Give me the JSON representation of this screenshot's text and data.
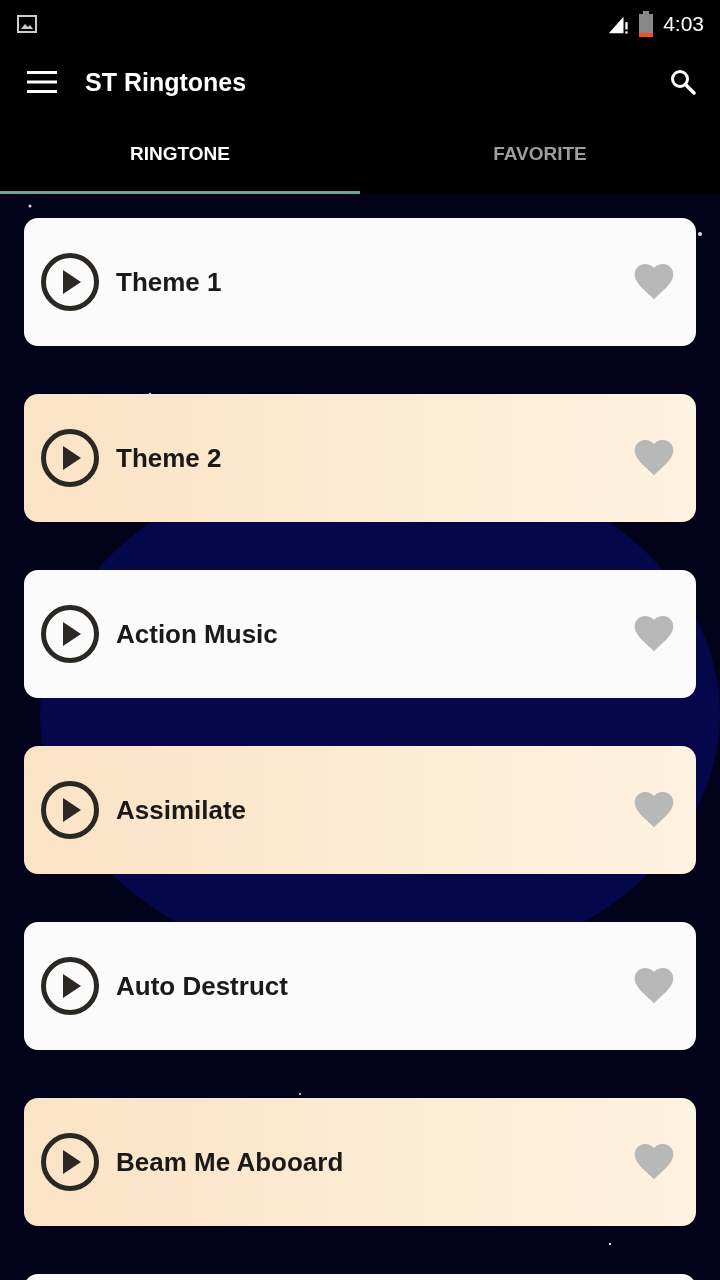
{
  "status_bar": {
    "time": "4:03"
  },
  "app_bar": {
    "title": "ST Ringtones"
  },
  "tabs": [
    {
      "label": "RINGTONE",
      "selected": true
    },
    {
      "label": "FAVORITE",
      "selected": false
    }
  ],
  "ringtones": [
    {
      "title": "Theme 1",
      "favorite": false
    },
    {
      "title": "Theme 2",
      "favorite": false
    },
    {
      "title": "Action Music",
      "favorite": false
    },
    {
      "title": "Assimilate",
      "favorite": false
    },
    {
      "title": "Auto Destruct",
      "favorite": false
    },
    {
      "title": "Beam Me Abooard",
      "favorite": false
    }
  ]
}
